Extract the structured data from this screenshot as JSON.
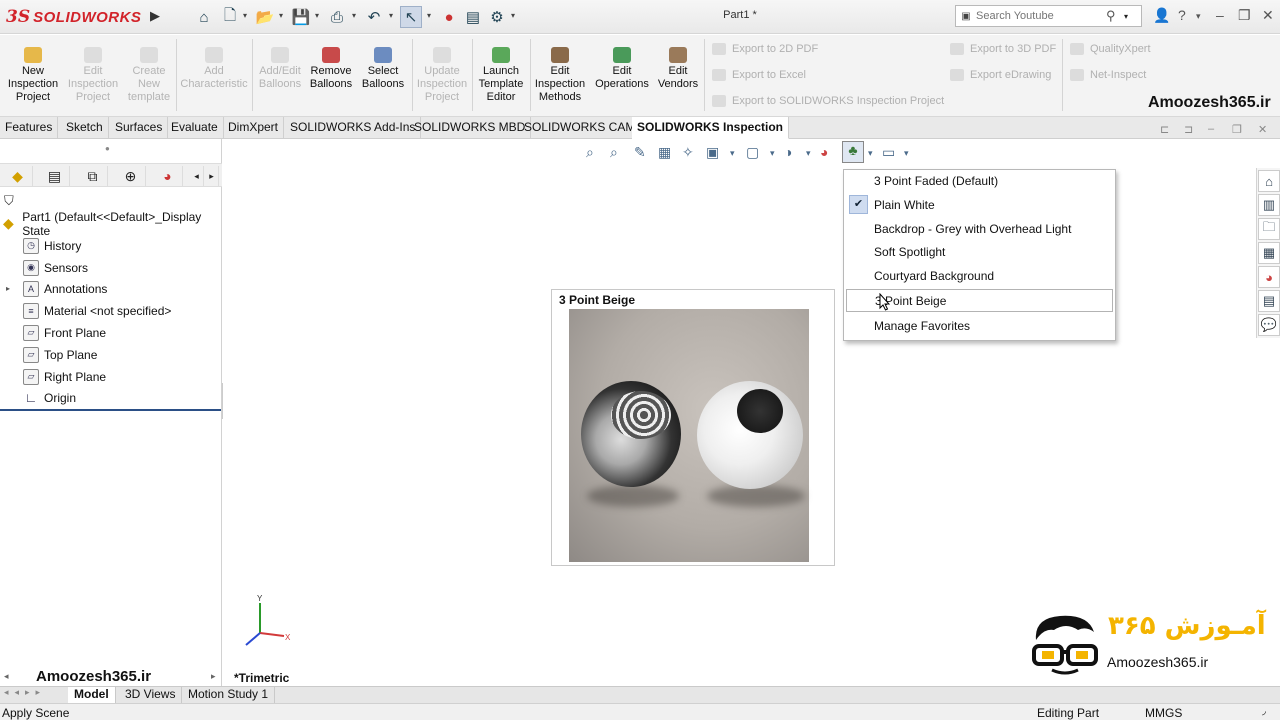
{
  "app": {
    "brand_ds": "3S",
    "brand_name": "SOLIDWORKS",
    "doc_title": "Part1 *"
  },
  "search": {
    "placeholder": "Search Youtube"
  },
  "ribbon": {
    "buttons": [
      {
        "label": "New Inspection Project",
        "enabled": true
      },
      {
        "label": "Edit Inspection Project",
        "enabled": false
      },
      {
        "label": "Create New template",
        "enabled": false
      },
      {
        "label": "Add Characteristic",
        "enabled": false
      },
      {
        "label": "Add/Edit Balloons",
        "enabled": false
      },
      {
        "label": "Remove Balloons",
        "enabled": true
      },
      {
        "label": "Select Balloons",
        "enabled": true
      },
      {
        "label": "Update Inspection Project",
        "enabled": false
      },
      {
        "label": "Launch Template Editor",
        "enabled": true
      },
      {
        "label": "Edit Inspection Methods",
        "enabled": true
      },
      {
        "label": "Edit Operations",
        "enabled": true
      },
      {
        "label": "Edit Vendors",
        "enabled": true
      }
    ],
    "exports": [
      "Export to 2D PDF",
      "Export to Excel",
      "Export to SOLIDWORKS Inspection Project",
      "Export to 3D PDF",
      "Export eDrawing"
    ],
    "addons": [
      "QualityXpert",
      "Net-Inspect"
    ],
    "watermark": "Amoozesh365.ir"
  },
  "tabs": [
    "Features",
    "Sketch",
    "Surfaces",
    "Evaluate",
    "DimXpert",
    "SOLIDWORKS Add-Ins",
    "SOLIDWORKS MBD",
    "SOLIDWORKS CAM",
    "SOLIDWORKS Inspection"
  ],
  "active_tab": "SOLIDWORKS Inspection",
  "tree": {
    "root": "Part1  (Default<<Default>_Display State",
    "items": [
      "History",
      "Sensors",
      "Annotations",
      "Material <not specified>",
      "Front Plane",
      "Top Plane",
      "Right Plane",
      "Origin"
    ]
  },
  "left_watermark": "Amoozesh365.ir",
  "preview": {
    "title": "3 Point Beige"
  },
  "scene_menu": {
    "items": [
      "3 Point Faded  (Default)",
      "Plain White",
      "Backdrop - Grey with Overhead Light",
      "Soft Spotlight",
      "Courtyard Background",
      "3 Point Beige",
      "Manage Favorites"
    ],
    "checked": "Plain White",
    "hovered": "3 Point Beige",
    "check_mark": "✔"
  },
  "view": {
    "label": "*Trimetric",
    "axis_x": "X",
    "axis_y": "Y"
  },
  "brand": {
    "fa": "آمـوزش ۳۶۵",
    "en": "Amoozesh365.ir"
  },
  "bottom_tabs": [
    "Model",
    "3D Views",
    "Motion Study 1"
  ],
  "active_bottom_tab": "Model",
  "status": {
    "left": "Apply Scene",
    "mode": "Editing Part",
    "units": "MMGS"
  },
  "colors": {
    "accent": "#d2232a",
    "selection": "#2b4f86"
  }
}
